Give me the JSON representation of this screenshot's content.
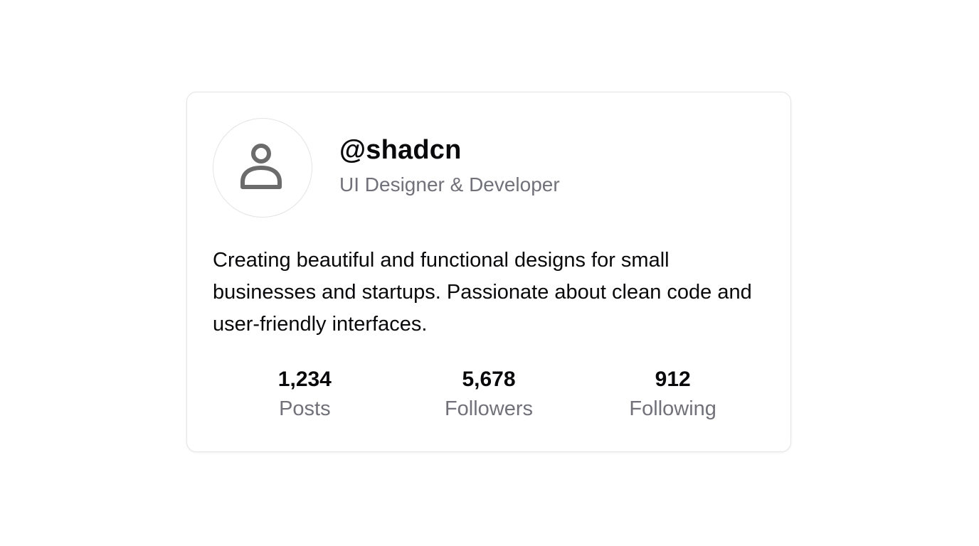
{
  "profile": {
    "avatar_icon": "user-icon",
    "username": "@shadcn",
    "role": "UI Designer & Developer",
    "bio": "Creating beautiful and functional designs for small businesses and startups. Passionate about clean code and user-friendly interfaces."
  },
  "stats": [
    {
      "value": "1,234",
      "label": "Posts"
    },
    {
      "value": "5,678",
      "label": "Followers"
    },
    {
      "value": "912",
      "label": "Following"
    }
  ],
  "colors": {
    "text": "#09090b",
    "muted": "#71717a",
    "border": "#e4e4e7",
    "icon": "#6b6b6b"
  }
}
